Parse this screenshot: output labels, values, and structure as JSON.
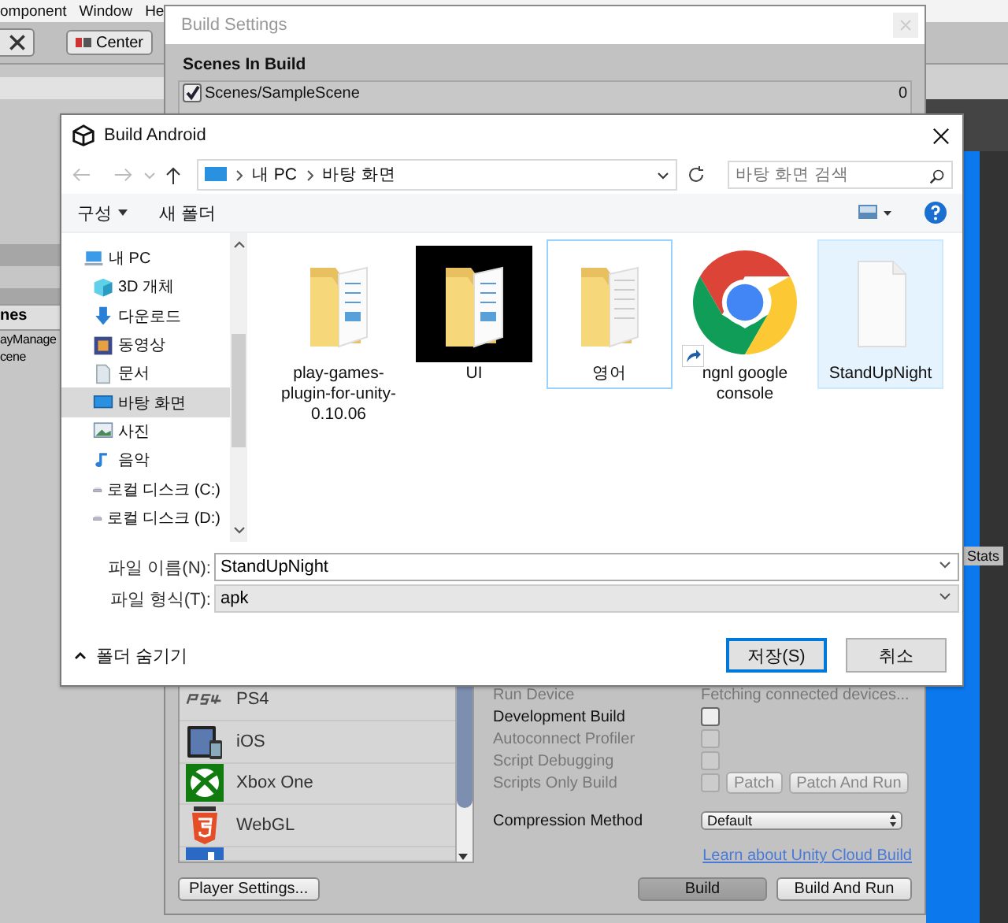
{
  "editor": {
    "menu": [
      "omponent",
      "Window",
      "He"
    ],
    "pivot_button": "Center",
    "hierarchy": {
      "header": "nes",
      "items": [
        "ayManage",
        "cene"
      ]
    },
    "stats_button": "Stats"
  },
  "build_settings": {
    "title": "Build Settings",
    "scenes_header": "Scenes In Build",
    "scenes": [
      {
        "name": "Scenes/SampleScene",
        "index": "0",
        "checked": true
      }
    ],
    "platforms": [
      {
        "name": "PS4",
        "kind": "ps4"
      },
      {
        "name": "iOS",
        "kind": "ios"
      },
      {
        "name": "Xbox One",
        "kind": "xbox"
      },
      {
        "name": "WebGL",
        "kind": "webgl"
      },
      {
        "kind": "partial"
      }
    ],
    "options": [
      {
        "kind": "value",
        "label": "Run Device",
        "value": "Fetching connected devices...",
        "disabled": true
      },
      {
        "kind": "checkbox",
        "label": "Development Build",
        "checked": false,
        "disabled": false
      },
      {
        "kind": "checkbox",
        "label": "Autoconnect Profiler",
        "checked": false,
        "disabled": true
      },
      {
        "kind": "checkbox",
        "label": "Script Debugging",
        "checked": false,
        "disabled": true
      },
      {
        "kind": "checkbox-buttons",
        "label": "Scripts Only Build",
        "checked": false,
        "disabled": true,
        "buttons": [
          "Patch",
          "Patch And Run"
        ]
      },
      {
        "kind": "dropdown",
        "label": "Compression Method",
        "value": "Default",
        "disabled": false
      }
    ],
    "cloud_link": "Learn about Unity Cloud Build",
    "player_settings_button": "Player Settings...",
    "build_button": "Build",
    "build_and_run_button": "Build And Run"
  },
  "dialog": {
    "title": "Build Android",
    "path": [
      "내 PC",
      "바탕 화면"
    ],
    "search_placeholder": "바탕 화면 검색",
    "toolbar": [
      "구성",
      "새 폴더"
    ],
    "nav": [
      {
        "label": "내 PC",
        "kind": "pc",
        "selected": false
      },
      {
        "label": "3D 개체",
        "kind": "cube",
        "selected": false
      },
      {
        "label": "다운로드",
        "kind": "download",
        "selected": false
      },
      {
        "label": "동영상",
        "kind": "video",
        "selected": false
      },
      {
        "label": "문서",
        "kind": "document",
        "selected": false
      },
      {
        "label": "바탕 화면",
        "kind": "desktop",
        "selected": true
      },
      {
        "label": "사진",
        "kind": "pictures",
        "selected": false
      },
      {
        "label": "음악",
        "kind": "music",
        "selected": false
      },
      {
        "label": "로컬 디스크 (C:)",
        "kind": "drive",
        "selected": false
      },
      {
        "label": "로컬 디스크 (D:)",
        "kind": "drive",
        "selected": false
      }
    ],
    "files": [
      {
        "name": "play-games-plugin-for-unity-0.10.06",
        "kind": "folder",
        "selected": false,
        "focused": false
      },
      {
        "name": "UI",
        "kind": "folder-dark",
        "selected": false,
        "focused": false
      },
      {
        "name": "영어",
        "kind": "folder-doc",
        "selected": false,
        "focused": true
      },
      {
        "name": "ngnl google console",
        "kind": "shortcut",
        "selected": false,
        "focused": false
      },
      {
        "name": "StandUpNight",
        "kind": "file",
        "selected": true,
        "focused": false
      }
    ],
    "file_name": {
      "label": "파일 이름(N):",
      "value": "StandUpNight"
    },
    "file_type": {
      "label": "파일 형식(T):",
      "value": "apk"
    },
    "hide_folders": "폴더 숨기기",
    "save_button": "저장(S)",
    "cancel_button": "취소"
  }
}
